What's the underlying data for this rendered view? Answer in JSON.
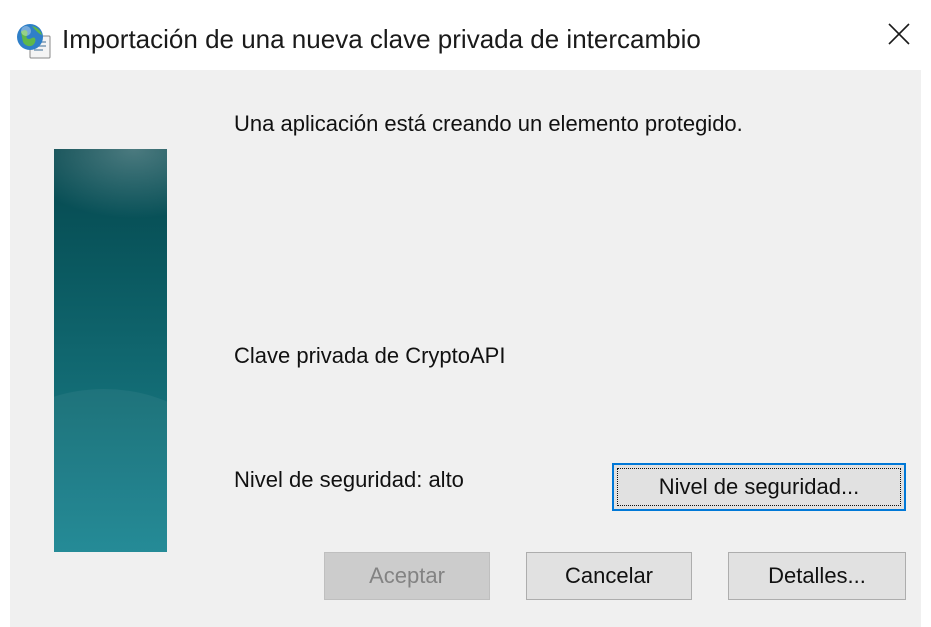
{
  "window": {
    "title": "Importación de una nueva clave privada de intercambio",
    "title_icon": "globe-certificate-icon",
    "close_icon": "close-icon"
  },
  "content": {
    "message": "Una aplicación está creando un elemento protegido.",
    "item_name": "Clave privada de CryptoAPI",
    "security_level_text": "Nivel de seguridad: alto"
  },
  "buttons": {
    "security_level": "Nivel de seguridad...",
    "accept": "Aceptar",
    "cancel": "Cancelar",
    "details": "Detalles..."
  },
  "colors": {
    "panel_top": "#06474e",
    "panel_bottom": "#1a8592",
    "focus_border": "#0078d7",
    "dialog_bg": "#f0f0f0"
  }
}
